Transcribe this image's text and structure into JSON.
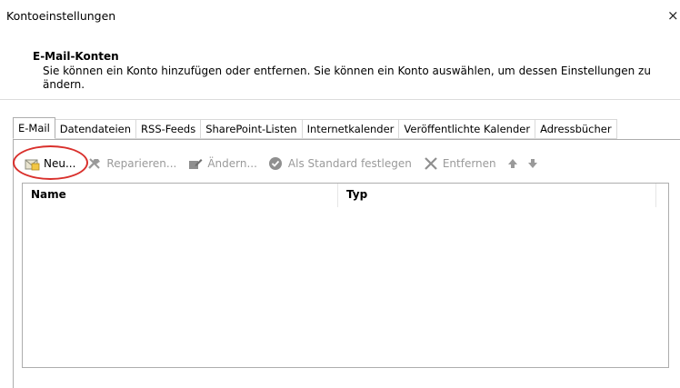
{
  "window": {
    "title": "Kontoeinstellungen",
    "close_glyph": "×"
  },
  "section": {
    "heading": "E-Mail-Konten",
    "description": "Sie können ein Konto hinzufügen oder entfernen. Sie können ein Konto auswählen, um dessen Einstellungen zu ändern."
  },
  "tabs": [
    {
      "label": "E-Mail",
      "active": true
    },
    {
      "label": "Datendateien",
      "active": false
    },
    {
      "label": "RSS-Feeds",
      "active": false
    },
    {
      "label": "SharePoint-Listen",
      "active": false
    },
    {
      "label": "Internetkalender",
      "active": false
    },
    {
      "label": "Veröffentlichte Kalender",
      "active": false
    },
    {
      "label": "Adressbücher",
      "active": false
    }
  ],
  "toolbar": {
    "new_label": "Neu...",
    "repair_label": "Reparieren...",
    "change_label": "Ändern...",
    "default_label": "Als Standard festlegen",
    "remove_label": "Entfernen",
    "up_icon": "arrow-up-icon",
    "down_icon": "arrow-down-icon"
  },
  "account_list": {
    "columns": [
      "Name",
      "Typ"
    ],
    "rows": []
  },
  "colors": {
    "highlight": "#d9302c",
    "disabled_text": "#9a9a9a"
  }
}
